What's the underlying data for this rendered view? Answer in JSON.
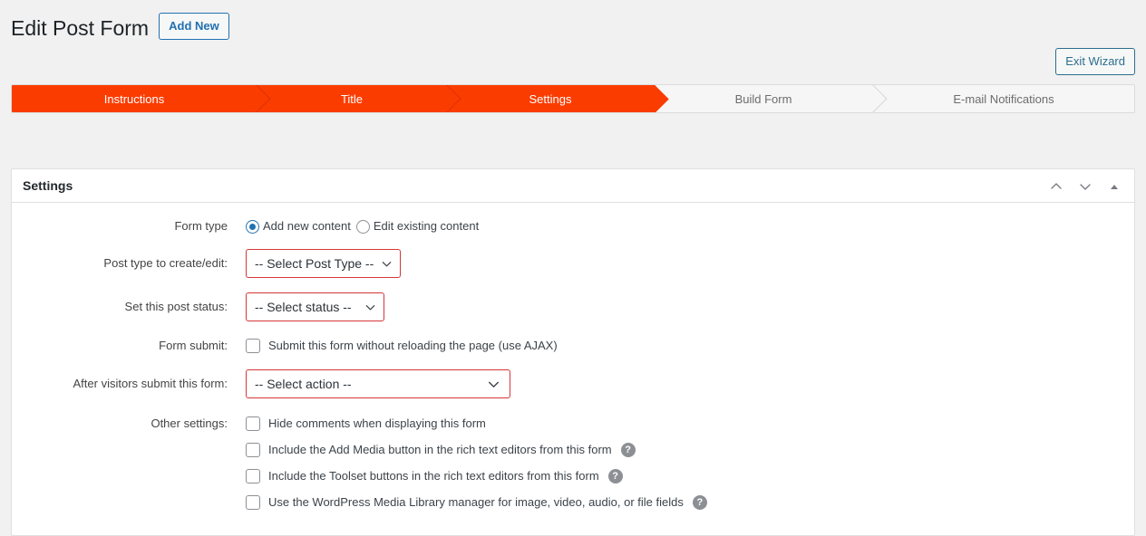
{
  "header": {
    "page_title": "Edit Post Form",
    "add_new_label": "Add New",
    "exit_wizard_label": "Exit Wizard"
  },
  "wizard": {
    "steps": [
      {
        "label": "Instructions",
        "state": "active"
      },
      {
        "label": "Title",
        "state": "active"
      },
      {
        "label": "Settings",
        "state": "active-current"
      },
      {
        "label": "Build Form",
        "state": "inactive"
      },
      {
        "label": "E-mail Notifications",
        "state": "inactive"
      }
    ],
    "active_color": "#fb3c00",
    "inactive_bg": "#f6f6f6",
    "inactive_text": "#6c6c6c"
  },
  "panel": {
    "title": "Settings",
    "icons": {
      "move_up": "chevron-up-icon",
      "move_down": "chevron-down-icon",
      "collapse": "triangle-up-icon"
    }
  },
  "form": {
    "form_type": {
      "label": "Form type",
      "options": [
        {
          "label": "Add new content",
          "selected": true
        },
        {
          "label": "Edit existing content",
          "selected": false
        }
      ]
    },
    "post_type": {
      "label": "Post type to create/edit:",
      "value": "-- Select Post Type --"
    },
    "post_status": {
      "label": "Set this post status:",
      "value": "-- Select status --"
    },
    "form_submit": {
      "label": "Form submit:",
      "checkbox_label": "Submit this form without reloading the page (use AJAX)",
      "checked": false
    },
    "after_submit": {
      "label": "After visitors submit this form:",
      "value": "-- Select action --"
    },
    "other_settings": {
      "label": "Other settings:",
      "items": [
        {
          "label": "Hide comments when displaying this form",
          "checked": false,
          "help": false
        },
        {
          "label": "Include the Add Media button in the rich text editors from this form",
          "checked": false,
          "help": true
        },
        {
          "label": "Include the Toolset buttons in the rich text editors from this form",
          "checked": false,
          "help": true
        },
        {
          "label": "Use the WordPress Media Library manager for image, video, audio, or file fields",
          "checked": false,
          "help": true
        }
      ],
      "help_glyph": "?"
    }
  },
  "colors": {
    "accent_orange": "#fb3c00",
    "link_blue": "#2271b1",
    "error_red": "#d63638",
    "page_bg": "#f1f1f1"
  }
}
